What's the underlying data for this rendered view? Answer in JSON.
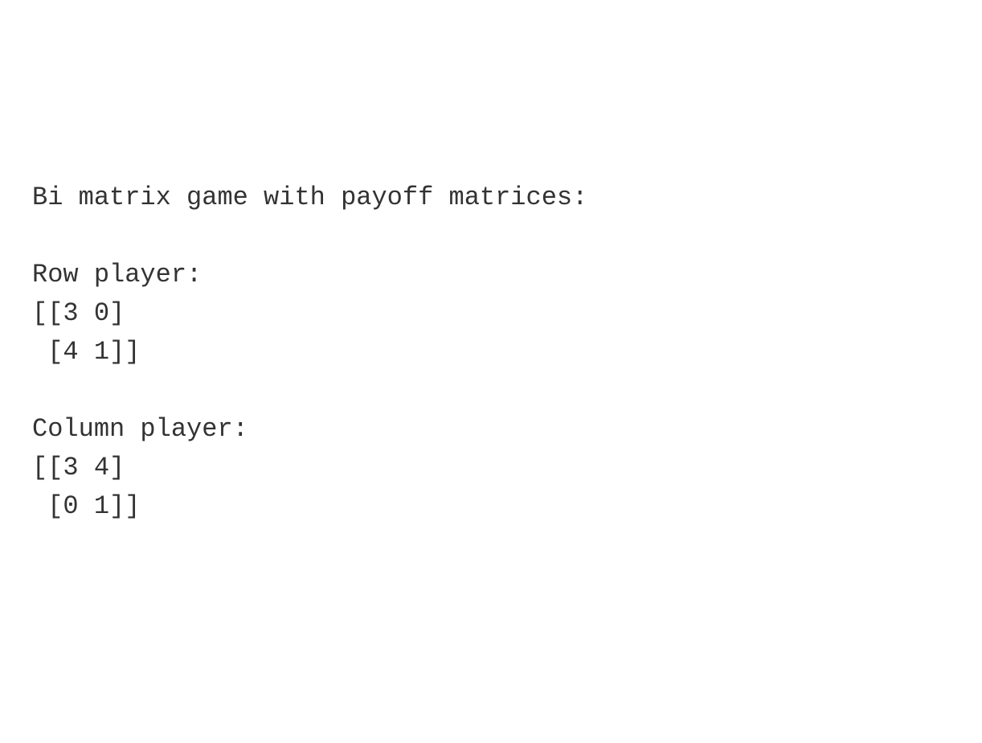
{
  "title_line": "Bi matrix game with payoff matrices:",
  "row_player": {
    "label": "Row player:",
    "row0": "[[3 0]",
    "row1": " [4 1]]"
  },
  "column_player": {
    "label": "Column player:",
    "row0": "[[3 4]",
    "row1": " [0 1]]"
  },
  "chart_data": {
    "type": "table",
    "title": "Bi matrix game with payoff matrices",
    "players": [
      {
        "name": "Row player",
        "matrix": [
          [
            3,
            0
          ],
          [
            4,
            1
          ]
        ]
      },
      {
        "name": "Column player",
        "matrix": [
          [
            3,
            4
          ],
          [
            0,
            1
          ]
        ]
      }
    ]
  }
}
